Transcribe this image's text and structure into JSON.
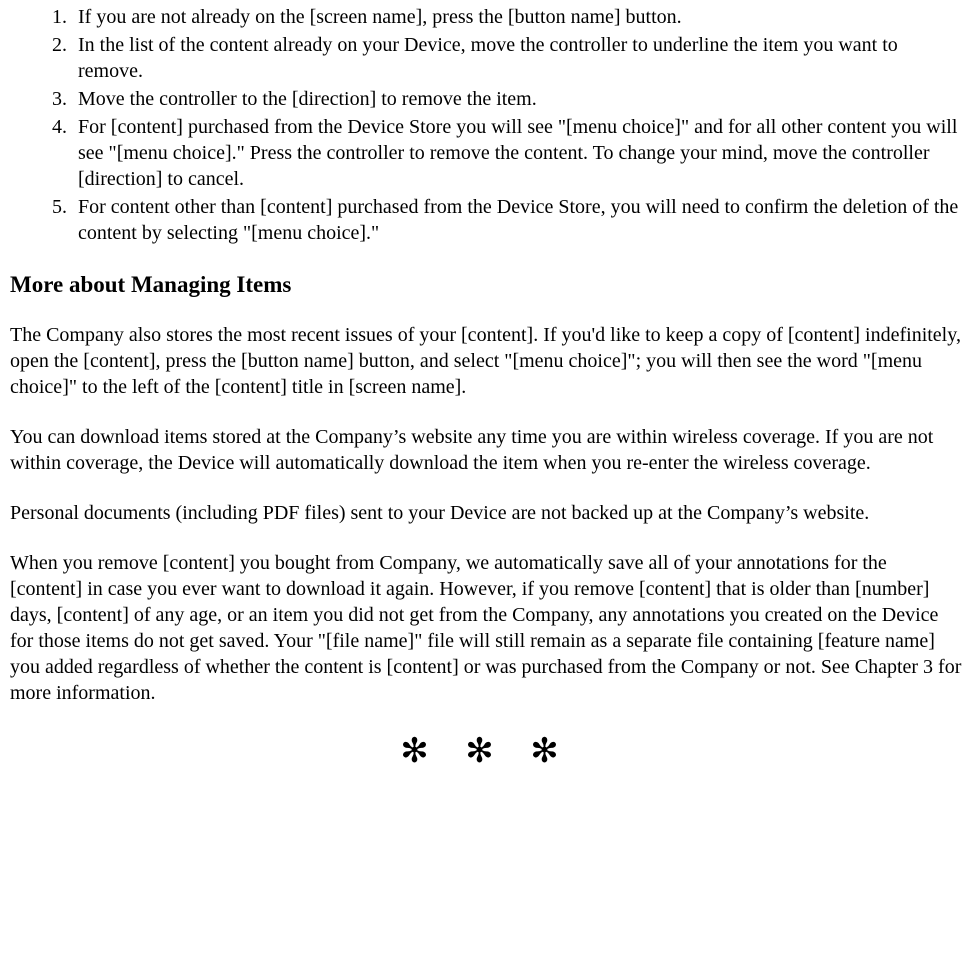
{
  "steps": [
    "If you are not already on the [screen name], press the [button name] button.",
    "In the list of the content already on your Device, move the controller to underline the item you want to remove.",
    "Move the controller to the [direction] to remove the item.",
    "For [content] purchased from the Device Store you will see \"[menu choice]\" and for all other content you will see \"[menu choice].\" Press the controller to remove the content. To change your mind, move the controller [direction] to cancel.",
    "For content other than [content] purchased from the Device Store, you will need to confirm the deletion of the content by selecting \"[menu choice].\""
  ],
  "heading": "More about Managing Items",
  "paragraphs": [
    "The Company also stores the most recent issues of your [content]. If you'd like to keep a copy of [content] indefinitely, open the [content], press the [button name] button, and select \"[menu choice]\"; you will then see the word \"[menu choice]\" to the left of the [content] title in [screen name].",
    "You can download items stored at the Company’s website any time you are within wireless coverage. If you are not within coverage, the Device will automatically download the item when you re-enter the wireless coverage.",
    "Personal documents (including PDF files) sent to your Device are not backed up at the Company’s website.",
    "When you remove [content] you bought from Company, we automatically save all of your annotations for the [content] in case you ever want to download it again. However, if you remove [content] that is older than [number] days, [content] of any age, or an item you did not get from the Company, any annotations you created on the Device for those items do not get saved. Your \"[file name]\" file will still remain as a separate file containing [feature name] you added regardless of whether the content is [content] or was purchased from the Company or not. See Chapter 3 for more information."
  ],
  "divider": "✻ ✻ ✻"
}
